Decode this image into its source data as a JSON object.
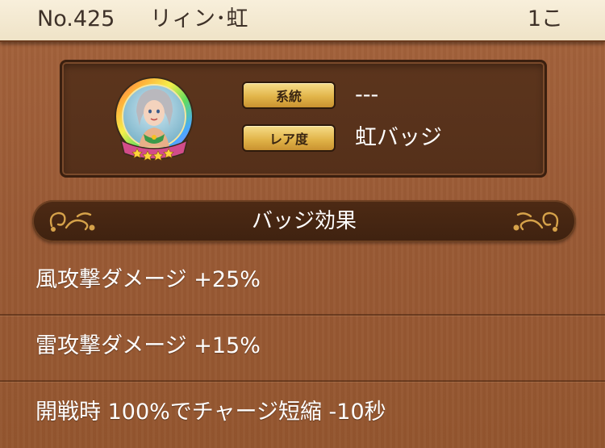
{
  "header": {
    "number": "No.425",
    "name": "リィン･虹",
    "count": "1こ"
  },
  "info": {
    "badge_icon": "rainbow-character-badge-icon",
    "system_label": "系統",
    "system_value": "---",
    "rarity_label": "レア度",
    "rarity_value": "虹バッジ"
  },
  "effects": {
    "title": "バッジ効果",
    "items": [
      "風攻撃ダメージ +25%",
      "雷攻撃ダメージ +15%",
      "開戦時 100%でチャージ短縮 -10秒"
    ]
  },
  "colors": {
    "background": "#9a5a35",
    "header_bg": "#f3e8cf",
    "gold_label": "#e2b54a",
    "panel_dark": "#5c351d"
  }
}
